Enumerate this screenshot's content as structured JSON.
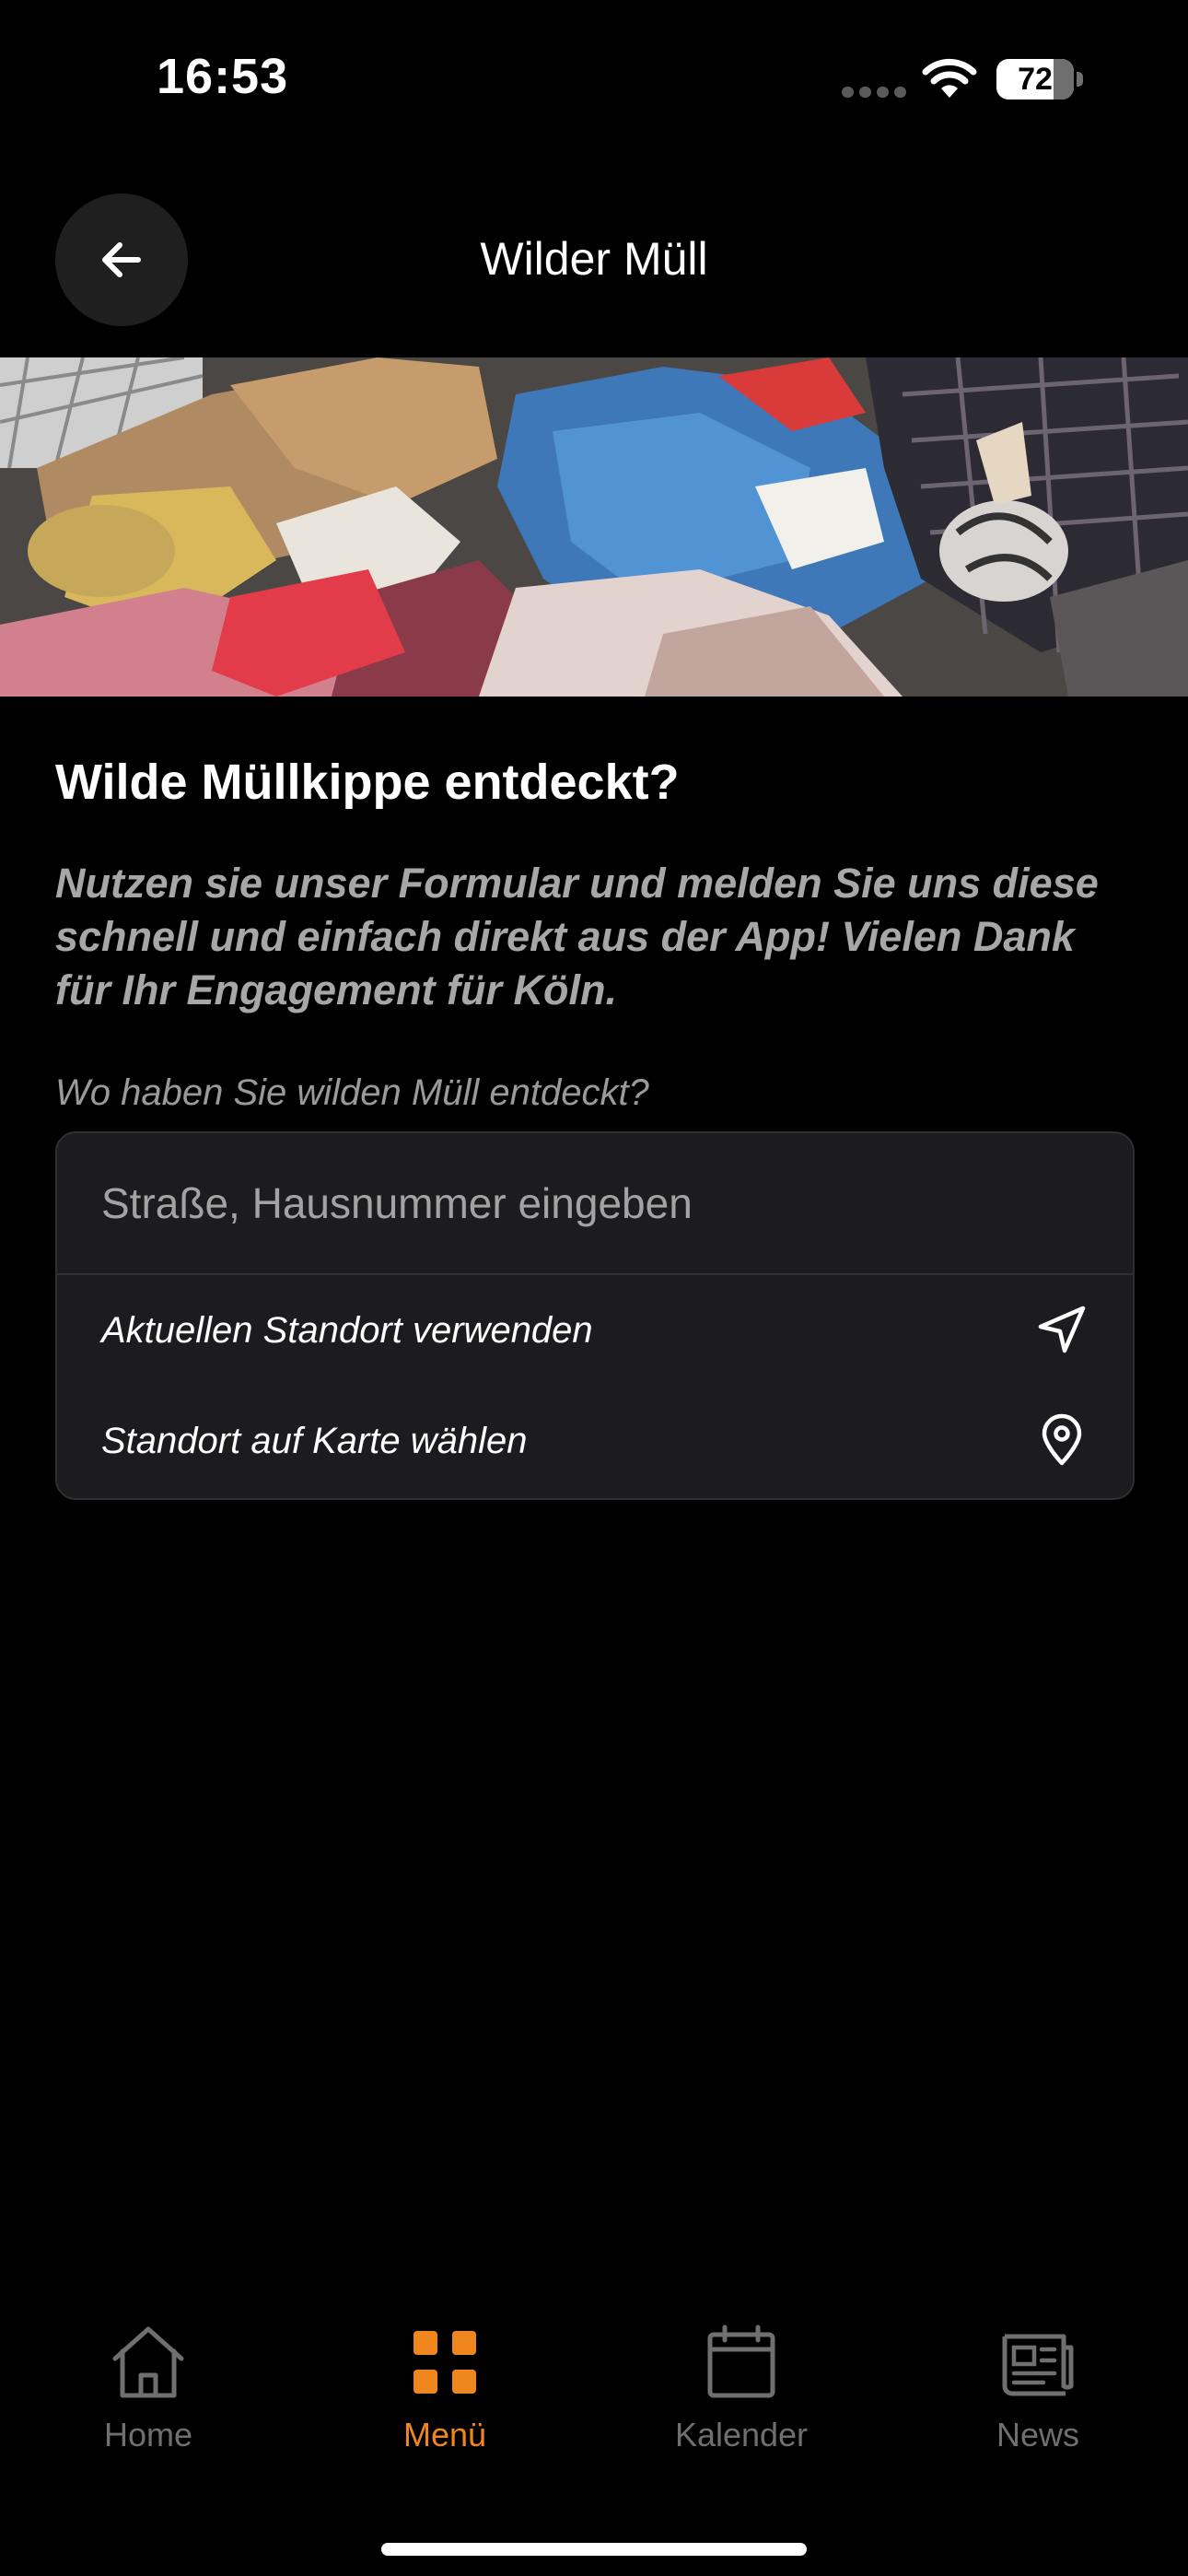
{
  "status_bar": {
    "time": "16:53",
    "battery_level": "72"
  },
  "header": {
    "title": "Wilder Müll",
    "back_icon": "arrow-left-icon"
  },
  "hero": {
    "image": "photo of illegally dumped trash on a street"
  },
  "content": {
    "title": "Wilde Müllkippe entdeckt?",
    "intro": "Nutzen sie unser Formular und melden Sie uns diese schnell und einfach direkt aus der App! Vielen Dank für Ihr Engagement für Köln.",
    "location_label": "Wo haben Sie wilden Müll entdeckt?"
  },
  "location": {
    "address_placeholder": "Straße, Hausnummer eingeben",
    "address_value": "",
    "use_current_location": "Aktuellen Standort verwenden",
    "current_location_icon": "navigation-arrow-icon",
    "choose_on_map": "Standort auf Karte wählen",
    "map_pin_icon": "map-pin-icon"
  },
  "tab_bar": {
    "active": "menu",
    "accent_color": "#f0861e",
    "inactive_color": "#6f6f6f",
    "tabs": [
      {
        "id": "home",
        "label": "Home",
        "icon": "home-icon"
      },
      {
        "id": "menu",
        "label": "Menü",
        "icon": "grid-icon"
      },
      {
        "id": "calendar",
        "label": "Kalender",
        "icon": "calendar-icon"
      },
      {
        "id": "news",
        "label": "News",
        "icon": "newspaper-icon"
      }
    ]
  }
}
